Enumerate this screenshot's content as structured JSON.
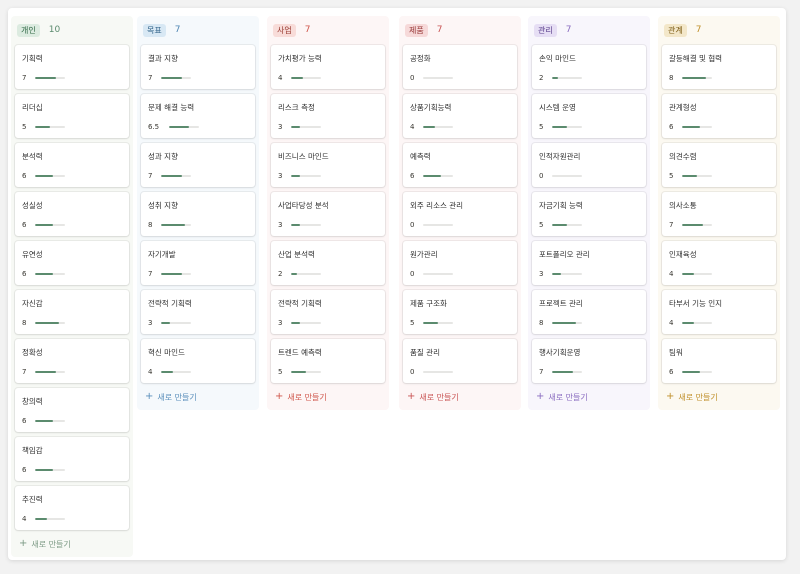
{
  "columns": [
    {
      "tag": "개인",
      "count": "10",
      "colors": {
        "bg": "#f7f9f5",
        "tag_bg": "#dcebe0",
        "tag_fg": "#2f6844",
        "count_fg": "#5b8b6e",
        "add_fg": "#7c9a85"
      },
      "add_label": "새로 만들기",
      "cards": [
        {
          "title": "기획력",
          "score": "7",
          "progress": 0.7
        },
        {
          "title": "리더십",
          "score": "5",
          "progress": 0.5
        },
        {
          "title": "분석력",
          "score": "6",
          "progress": 0.6
        },
        {
          "title": "성실성",
          "score": "6",
          "progress": 0.6
        },
        {
          "title": "유연성",
          "score": "6",
          "progress": 0.6
        },
        {
          "title": "자신감",
          "score": "8",
          "progress": 0.8
        },
        {
          "title": "정확성",
          "score": "7",
          "progress": 0.7
        },
        {
          "title": "창의력",
          "score": "6",
          "progress": 0.6
        },
        {
          "title": "책임감",
          "score": "6",
          "progress": 0.6
        },
        {
          "title": "추진력",
          "score": "4",
          "progress": 0.4
        }
      ]
    },
    {
      "tag": "목표",
      "count": "7",
      "colors": {
        "bg": "#f5f9fc",
        "tag_bg": "#d8e8f4",
        "tag_fg": "#2c5f86",
        "count_fg": "#4f86b3",
        "add_fg": "#5a8fbb"
      },
      "add_label": "새로 만들기",
      "cards": [
        {
          "title": "결과 지향",
          "score": "7",
          "progress": 0.7
        },
        {
          "title": "문제 해결 능력",
          "score": "6.5",
          "progress": 0.65
        },
        {
          "title": "성과 지향",
          "score": "7",
          "progress": 0.7
        },
        {
          "title": "성취 지향",
          "score": "8",
          "progress": 0.8
        },
        {
          "title": "자기개발",
          "score": "7",
          "progress": 0.7
        },
        {
          "title": "전략적 기획력",
          "score": "3",
          "progress": 0.3
        },
        {
          "title": "혁신 마인드",
          "score": "4",
          "progress": 0.4
        }
      ]
    },
    {
      "tag": "사업",
      "count": "7",
      "colors": {
        "bg": "#fdf6f6",
        "tag_bg": "#f8dcd9",
        "tag_fg": "#9a3b32",
        "count_fg": "#d0574c",
        "add_fg": "#d0574c"
      },
      "add_label": "새로 만들기",
      "cards": [
        {
          "title": "가치평가 능력",
          "score": "4",
          "progress": 0.4
        },
        {
          "title": "리스크 측정",
          "score": "3",
          "progress": 0.3
        },
        {
          "title": "비즈니스 마인드",
          "score": "3",
          "progress": 0.3
        },
        {
          "title": "사업타당성 분석",
          "score": "3",
          "progress": 0.3
        },
        {
          "title": "산업 분석력",
          "score": "2",
          "progress": 0.2
        },
        {
          "title": "전략적 기획력",
          "score": "3",
          "progress": 0.3
        },
        {
          "title": "트렌드 예측력",
          "score": "5",
          "progress": 0.5
        }
      ]
    },
    {
      "tag": "제품",
      "count": "7",
      "colors": {
        "bg": "#fdf6f6",
        "tag_bg": "#f6d9d9",
        "tag_fg": "#963434",
        "count_fg": "#c95454",
        "add_fg": "#c95454"
      },
      "add_label": "새로 만들기",
      "cards": [
        {
          "title": "공정화",
          "score": "0",
          "progress": 0
        },
        {
          "title": "상품기획능력",
          "score": "4",
          "progress": 0.4
        },
        {
          "title": "예측력",
          "score": "6",
          "progress": 0.6
        },
        {
          "title": "외주 리소스 관리",
          "score": "0",
          "progress": 0
        },
        {
          "title": "원가관리",
          "score": "0",
          "progress": 0
        },
        {
          "title": "제품 구조화",
          "score": "5",
          "progress": 0.5
        },
        {
          "title": "품질 관리",
          "score": "0",
          "progress": 0
        }
      ]
    },
    {
      "tag": "관리",
      "count": "7",
      "colors": {
        "bg": "#f8f6fc",
        "tag_bg": "#e6def4",
        "tag_fg": "#5a3e8c",
        "count_fg": "#8a6cc0",
        "add_fg": "#8a6cc0"
      },
      "add_label": "새로 만들기",
      "cards": [
        {
          "title": "손익 마인드",
          "score": "2",
          "progress": 0.2
        },
        {
          "title": "시스템 운영",
          "score": "5",
          "progress": 0.5
        },
        {
          "title": "인적자원관리",
          "score": "0",
          "progress": 0
        },
        {
          "title": "자금기획 능력",
          "score": "5",
          "progress": 0.5
        },
        {
          "title": "포트폴리오 관리",
          "score": "3",
          "progress": 0.3
        },
        {
          "title": "프로젝트 관리",
          "score": "8",
          "progress": 0.8
        },
        {
          "title": "행사기획운영",
          "score": "7",
          "progress": 0.7
        }
      ]
    },
    {
      "tag": "관계",
      "count": "7",
      "colors": {
        "bg": "#fcf9f1",
        "tag_bg": "#f3e7c9",
        "tag_fg": "#7d5c14",
        "count_fg": "#c0902a",
        "add_fg": "#c0902a"
      },
      "add_label": "새로 만들기",
      "cards": [
        {
          "title": "갈등해결 및 협력",
          "score": "8",
          "progress": 0.8
        },
        {
          "title": "관계형성",
          "score": "6",
          "progress": 0.6
        },
        {
          "title": "의견수렴",
          "score": "5",
          "progress": 0.5
        },
        {
          "title": "의사소통",
          "score": "7",
          "progress": 0.7
        },
        {
          "title": "인재육성",
          "score": "4",
          "progress": 0.4
        },
        {
          "title": "타부서 기능 인지",
          "score": "4",
          "progress": 0.4
        },
        {
          "title": "팀워",
          "score": "6",
          "progress": 0.6
        }
      ]
    }
  ]
}
